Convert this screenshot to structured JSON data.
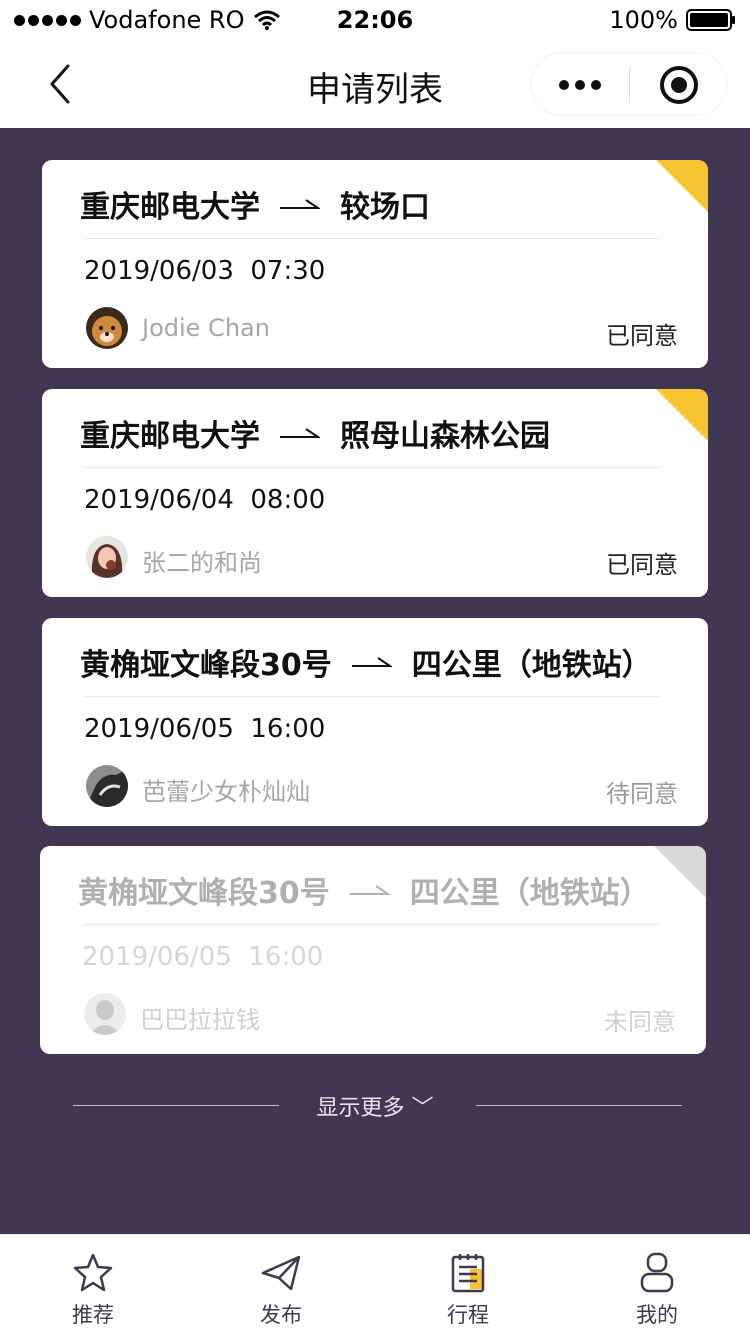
{
  "status_bar": {
    "carrier": "Vodafone RO",
    "time": "22:06",
    "battery": "100%"
  },
  "nav": {
    "title": "申请列表"
  },
  "cards": [
    {
      "from": "重庆邮电大学",
      "to": "较场口",
      "datetime": "2019/06/03  07:30",
      "user": "Jodie Chan",
      "status": "已同意",
      "corner_color": "#f8c431"
    },
    {
      "from": "重庆邮电大学",
      "to": "照母山森林公园",
      "datetime": "2019/06/04  08:00",
      "user": "张二的和尚",
      "status": "已同意",
      "corner_color": "#f8c431"
    },
    {
      "from": "黄桷垭文峰段30号",
      "to": "四公里（地铁站）",
      "datetime": "2019/06/05  16:00",
      "user": "芭蕾少女朴灿灿",
      "status": "待同意"
    },
    {
      "from": "黄桷垭文峰段30号",
      "to": "四公里（地铁站）",
      "datetime": "2019/06/05  16:00",
      "user": "巴巴拉拉钱",
      "status": "未同意",
      "corner_color": "#d9d9d9"
    }
  ],
  "show_more": {
    "label": "显示更多 ﹀"
  },
  "tabs": [
    {
      "label": "推荐",
      "icon": "star-icon"
    },
    {
      "label": "发布",
      "icon": "paper-plane-icon"
    },
    {
      "label": "行程",
      "icon": "clipboard-icon"
    },
    {
      "label": "我的",
      "icon": "user-icon"
    }
  ],
  "colors": {
    "background": "#413752",
    "accent": "#f8c431",
    "tab_icon": "#413752"
  }
}
